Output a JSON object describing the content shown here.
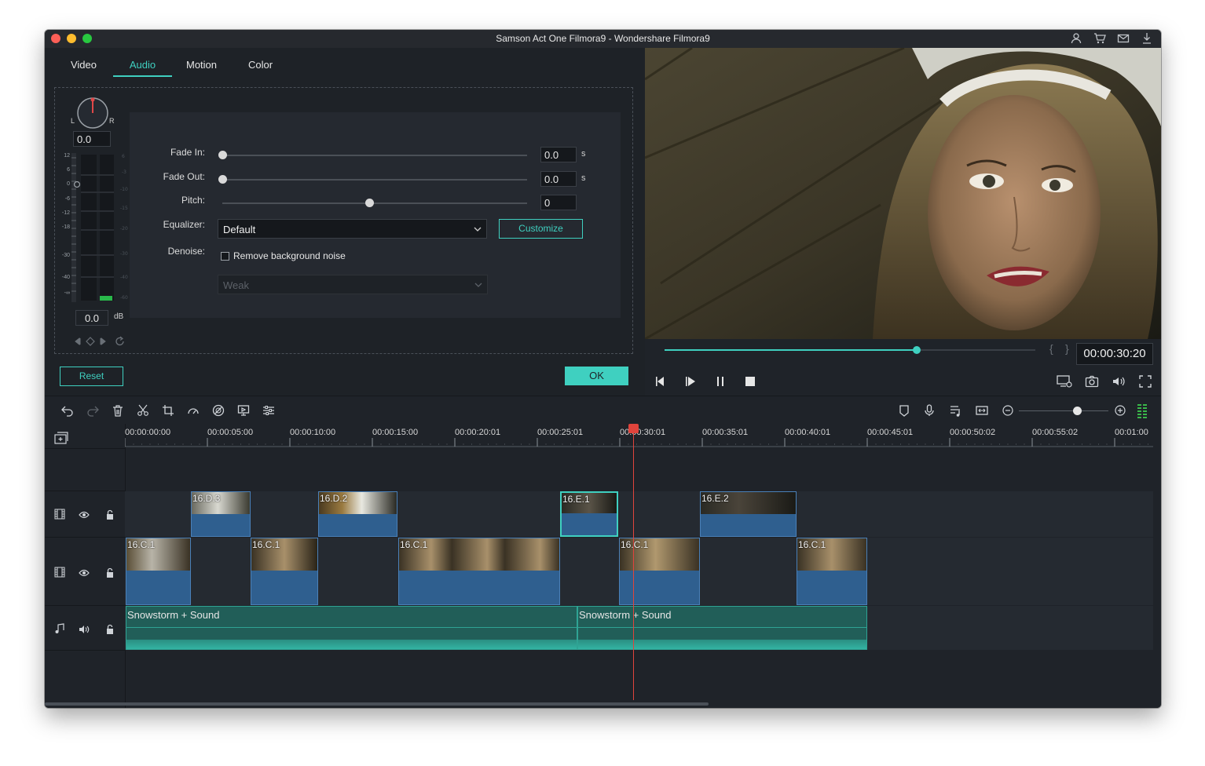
{
  "window": {
    "title": "Samson Act One Filmora9 - Wondershare Filmora9",
    "traffic_lights": [
      "#fc5f57",
      "#fdbc2e",
      "#28c840"
    ],
    "title_icons": [
      "user-icon",
      "cart-icon",
      "mail-icon",
      "download-icon"
    ]
  },
  "editor": {
    "tabs": [
      {
        "label": "Video",
        "active": false
      },
      {
        "label": "Audio",
        "active": true
      },
      {
        "label": "Motion",
        "active": false
      },
      {
        "label": "Color",
        "active": false
      }
    ],
    "pan": {
      "left": "L",
      "right": "R",
      "value": "0.0"
    },
    "meter": {
      "scale": [
        "12",
        "6",
        "0",
        "-6",
        "-12",
        "-18",
        "-30",
        "-40",
        "-∞"
      ],
      "db_value": "0.0",
      "db_unit": "dB"
    },
    "fade_in": {
      "label": "Fade In:",
      "value": "0.0",
      "unit": "s",
      "level": 0.0
    },
    "fade_out": {
      "label": "Fade Out:",
      "value": "0.0",
      "unit": "s",
      "level": 0.0
    },
    "pitch": {
      "label": "Pitch:",
      "value": "0",
      "level": 0.5
    },
    "equalizer": {
      "label": "Equalizer:",
      "value": "Default",
      "customize_label": "Customize"
    },
    "denoise": {
      "label": "Denoise:",
      "checkbox_label": "Remove background noise",
      "checked": false,
      "level_value": "Weak"
    },
    "reset_label": "Reset",
    "ok_label": "OK"
  },
  "preview": {
    "timecode": "00:00:30:20",
    "progress": 0.68,
    "in_mark": "{",
    "out_mark": "}"
  },
  "toolbar": {
    "left_icons": [
      "undo-icon",
      "redo-icon",
      "delete-icon",
      "cut-icon",
      "crop-icon",
      "speed-icon",
      "color-icon",
      "screen-icon",
      "adjust-icon"
    ],
    "right_icons": [
      "marker-icon",
      "mic-icon",
      "mixer-icon",
      "fit-icon",
      "zoom-out-icon",
      "zoom-in-icon",
      "level-meter-icon"
    ],
    "zoom_level": 0.65
  },
  "timeline": {
    "ruler": [
      "00:00:00:00",
      "00:00:05:00",
      "00:00:10:00",
      "00:00:15:00",
      "00:00:20:01",
      "00:00:25:01",
      "00:00:30:01",
      "00:00:35:01",
      "00:00:40:01",
      "00:00:45:01",
      "00:00:50:02",
      "00:00:55:02",
      "00:01:00"
    ],
    "playhead": "00:00:30:20",
    "track2_clips": [
      "16.D.3",
      "16.D.2",
      "16.E.1",
      "16.E.2"
    ],
    "track1_clips": [
      "16.C.1",
      "16.C.1",
      "16.C.1",
      "16.C.1",
      "16.C.1"
    ],
    "audio_clips": [
      "Snowstorm + Sound",
      "Snowstorm + Sound"
    ]
  }
}
